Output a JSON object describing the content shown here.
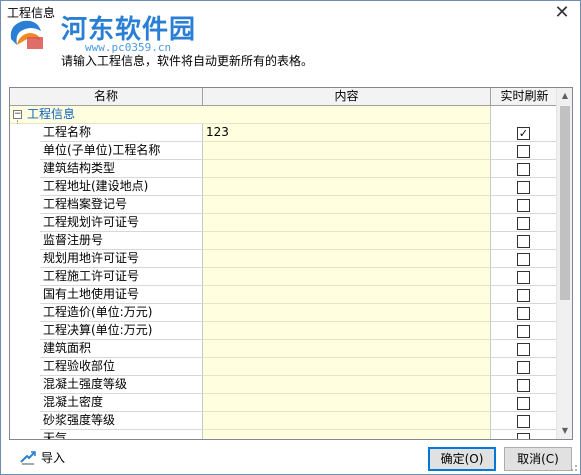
{
  "window": {
    "title": "工程信息",
    "close_glyph": "✕"
  },
  "watermark": {
    "text": "河东软件园",
    "url": "www.pc0359.cn"
  },
  "header": {
    "instruction": "请输入工程信息，软件将自动更新所有的表格。"
  },
  "grid": {
    "columns": {
      "name": "名称",
      "content": "内容",
      "refresh": "实时刷新"
    },
    "group": {
      "label": "工程信息",
      "expander": "−"
    },
    "rows": [
      {
        "name": "工程名称",
        "value": "123",
        "checked": true
      },
      {
        "name": "单位(子单位)工程名称",
        "value": "",
        "checked": false
      },
      {
        "name": "建筑结构类型",
        "value": "",
        "checked": false
      },
      {
        "name": "工程地址(建设地点)",
        "value": "",
        "checked": false
      },
      {
        "name": "工程档案登记号",
        "value": "",
        "checked": false
      },
      {
        "name": "工程规划许可证号",
        "value": "",
        "checked": false
      },
      {
        "name": "监督注册号",
        "value": "",
        "checked": false
      },
      {
        "name": "规划用地许可证号",
        "value": "",
        "checked": false
      },
      {
        "name": "工程施工许可证号",
        "value": "",
        "checked": false
      },
      {
        "name": "国有土地使用证号",
        "value": "",
        "checked": false
      },
      {
        "name": "工程造价(单位:万元)",
        "value": "",
        "checked": false
      },
      {
        "name": "工程决算(单位:万元)",
        "value": "",
        "checked": false
      },
      {
        "name": "建筑面积",
        "value": "",
        "checked": false
      },
      {
        "name": "工程验收部位",
        "value": "",
        "checked": false
      },
      {
        "name": "混凝土强度等级",
        "value": "",
        "checked": false
      },
      {
        "name": "混凝土密度",
        "value": "",
        "checked": false
      },
      {
        "name": "砂浆强度等级",
        "value": "",
        "checked": false
      },
      {
        "name": "天气",
        "value": "",
        "checked": false
      }
    ]
  },
  "footer": {
    "import_label": "导入",
    "ok_label": "确定(O)",
    "cancel_label": "取消(C)"
  },
  "colors": {
    "accent": "#0078d7",
    "content_bg": "#ffffe0",
    "group_text": "#0b5fbf",
    "watermark": "#2a7fd4"
  }
}
